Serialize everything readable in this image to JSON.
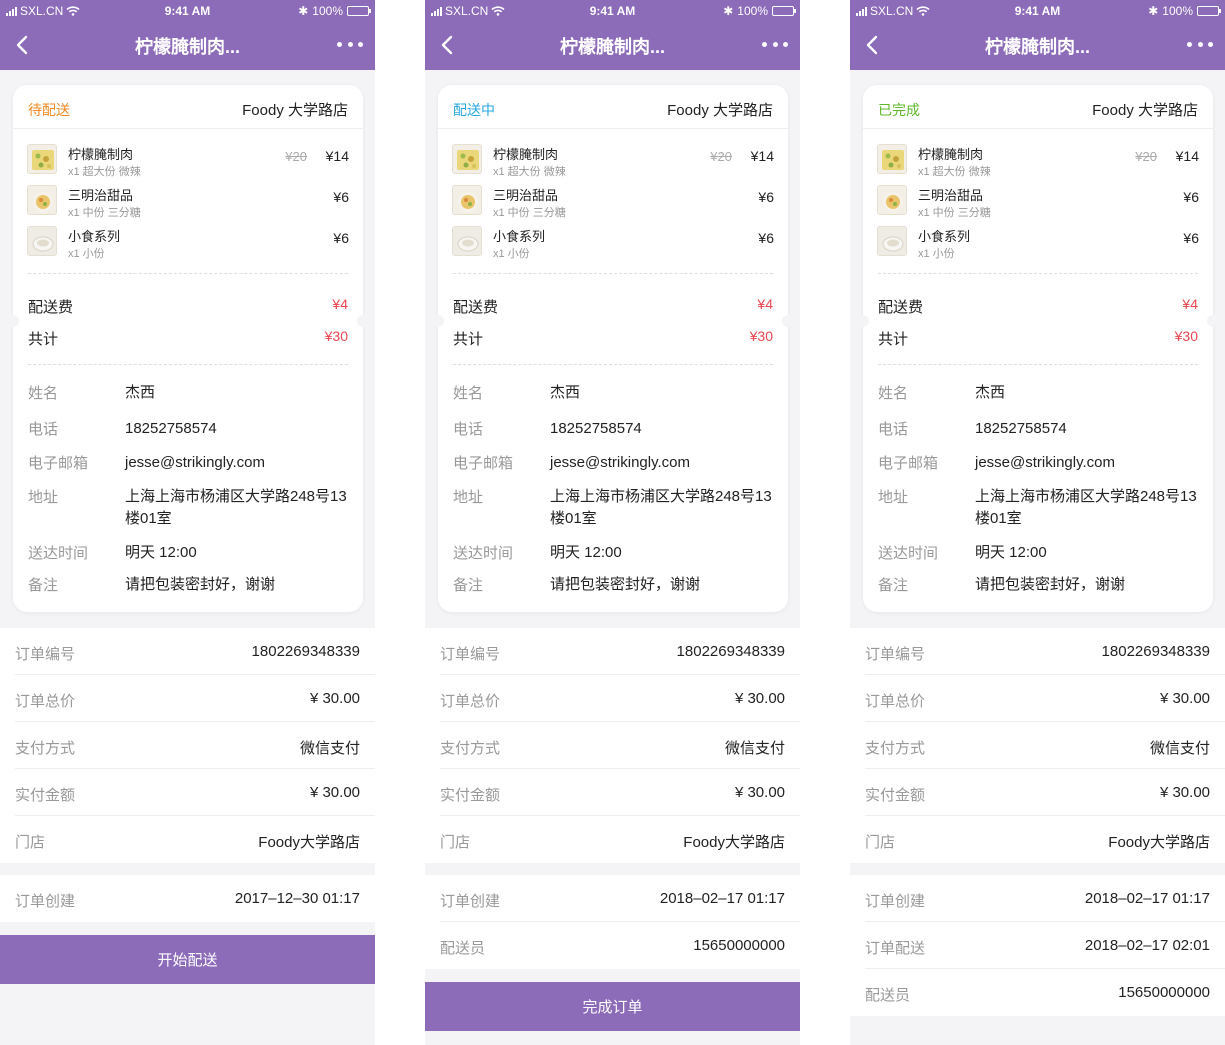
{
  "screens": [
    {
      "status_bar": {
        "carrier": "SXL.CN",
        "time": "9:41 AM",
        "battery": "100%"
      },
      "nav": {
        "title": "柠檬腌制肉..."
      },
      "order_card": {
        "status": "待配送",
        "status_color": "#f08a24",
        "store": "Foody 大学路店",
        "items": [
          {
            "name": "柠檬腌制肉",
            "spec": "x1 超大份 微辣",
            "old_price": "¥20",
            "price": "¥14"
          },
          {
            "name": "三明治甜品",
            "spec": "x1 中份 三分糖",
            "old_price": "",
            "price": "¥6"
          },
          {
            "name": "小食系列",
            "spec": "x1 小份",
            "old_price": "",
            "price": "¥6"
          }
        ],
        "delivery_fee_label": "配送费",
        "delivery_fee": "¥4",
        "total_label": "共计",
        "total": "¥30",
        "customer": [
          {
            "label": "姓名",
            "value": "杰西"
          },
          {
            "label": "电话",
            "value": "18252758574"
          },
          {
            "label": "电子邮箱",
            "value": "jesse@strikingly.com"
          },
          {
            "label": "地址",
            "value": "上海上海市杨浦区大学路248号13楼01室"
          },
          {
            "label": "送达时间",
            "value": "明天 12:00"
          },
          {
            "label": "备注",
            "value": "请把包装密封好，谢谢"
          }
        ]
      },
      "order_info": [
        {
          "label": "订单编号",
          "value": "1802269348339"
        },
        {
          "label": "订单总价",
          "value": "¥ 30.00"
        },
        {
          "label": "支付方式",
          "value": "微信支付"
        },
        {
          "label": "实付金额",
          "value": "¥ 30.00"
        },
        {
          "label": "门店",
          "value": "Foody大学路店"
        }
      ],
      "timeline": [
        {
          "label": "订单创建",
          "value": "2017–12–30 01:17"
        }
      ],
      "action_label": "开始配送"
    },
    {
      "status_bar": {
        "carrier": "SXL.CN",
        "time": "9:41 AM",
        "battery": "100%"
      },
      "nav": {
        "title": "柠檬腌制肉..."
      },
      "order_card": {
        "status": "配送中",
        "status_color": "#29a8e0",
        "store": "Foody 大学路店",
        "items": [
          {
            "name": "柠檬腌制肉",
            "spec": "x1 超大份 微辣",
            "old_price": "¥20",
            "price": "¥14"
          },
          {
            "name": "三明治甜品",
            "spec": "x1 中份 三分糖",
            "old_price": "",
            "price": "¥6"
          },
          {
            "name": "小食系列",
            "spec": "x1 小份",
            "old_price": "",
            "price": "¥6"
          }
        ],
        "delivery_fee_label": "配送费",
        "delivery_fee": "¥4",
        "total_label": "共计",
        "total": "¥30",
        "customer": [
          {
            "label": "姓名",
            "value": "杰西"
          },
          {
            "label": "电话",
            "value": "18252758574"
          },
          {
            "label": "电子邮箱",
            "value": "jesse@strikingly.com"
          },
          {
            "label": "地址",
            "value": "上海上海市杨浦区大学路248号13楼01室"
          },
          {
            "label": "送达时间",
            "value": "明天 12:00"
          },
          {
            "label": "备注",
            "value": "请把包装密封好，谢谢"
          }
        ]
      },
      "order_info": [
        {
          "label": "订单编号",
          "value": "1802269348339"
        },
        {
          "label": "订单总价",
          "value": "¥ 30.00"
        },
        {
          "label": "支付方式",
          "value": "微信支付"
        },
        {
          "label": "实付金额",
          "value": "¥ 30.00"
        },
        {
          "label": "门店",
          "value": "Foody大学路店"
        }
      ],
      "timeline": [
        {
          "label": "订单创建",
          "value": "2018–02–17 01:17"
        },
        {
          "label": "配送员",
          "value": "15650000000"
        }
      ],
      "action_label": "完成订单"
    },
    {
      "status_bar": {
        "carrier": "SXL.CN",
        "time": "9:41 AM",
        "battery": "100%"
      },
      "nav": {
        "title": "柠檬腌制肉..."
      },
      "order_card": {
        "status": "已完成",
        "status_color": "#5cb82a",
        "store": "Foody 大学路店",
        "items": [
          {
            "name": "柠檬腌制肉",
            "spec": "x1 超大份 微辣",
            "old_price": "¥20",
            "price": "¥14"
          },
          {
            "name": "三明治甜品",
            "spec": "x1 中份 三分糖",
            "old_price": "",
            "price": "¥6"
          },
          {
            "name": "小食系列",
            "spec": "x1 小份",
            "old_price": "",
            "price": "¥6"
          }
        ],
        "delivery_fee_label": "配送费",
        "delivery_fee": "¥4",
        "total_label": "共计",
        "total": "¥30",
        "customer": [
          {
            "label": "姓名",
            "value": "杰西"
          },
          {
            "label": "电话",
            "value": "18252758574"
          },
          {
            "label": "电子邮箱",
            "value": "jesse@strikingly.com"
          },
          {
            "label": "地址",
            "value": "上海上海市杨浦区大学路248号13楼01室"
          },
          {
            "label": "送达时间",
            "value": "明天 12:00"
          },
          {
            "label": "备注",
            "value": "请把包装密封好，谢谢"
          }
        ]
      },
      "order_info": [
        {
          "label": "订单编号",
          "value": "1802269348339"
        },
        {
          "label": "订单总价",
          "value": "¥ 30.00"
        },
        {
          "label": "支付方式",
          "value": "微信支付"
        },
        {
          "label": "实付金额",
          "value": "¥ 30.00"
        },
        {
          "label": "门店",
          "value": "Foody大学路店"
        }
      ],
      "timeline": [
        {
          "label": "订单创建",
          "value": "2018–02–17 01:17"
        },
        {
          "label": "订单配送",
          "value": "2018–02–17 02:01"
        },
        {
          "label": "配送员",
          "value": "15650000000"
        }
      ],
      "action_label": ""
    }
  ]
}
